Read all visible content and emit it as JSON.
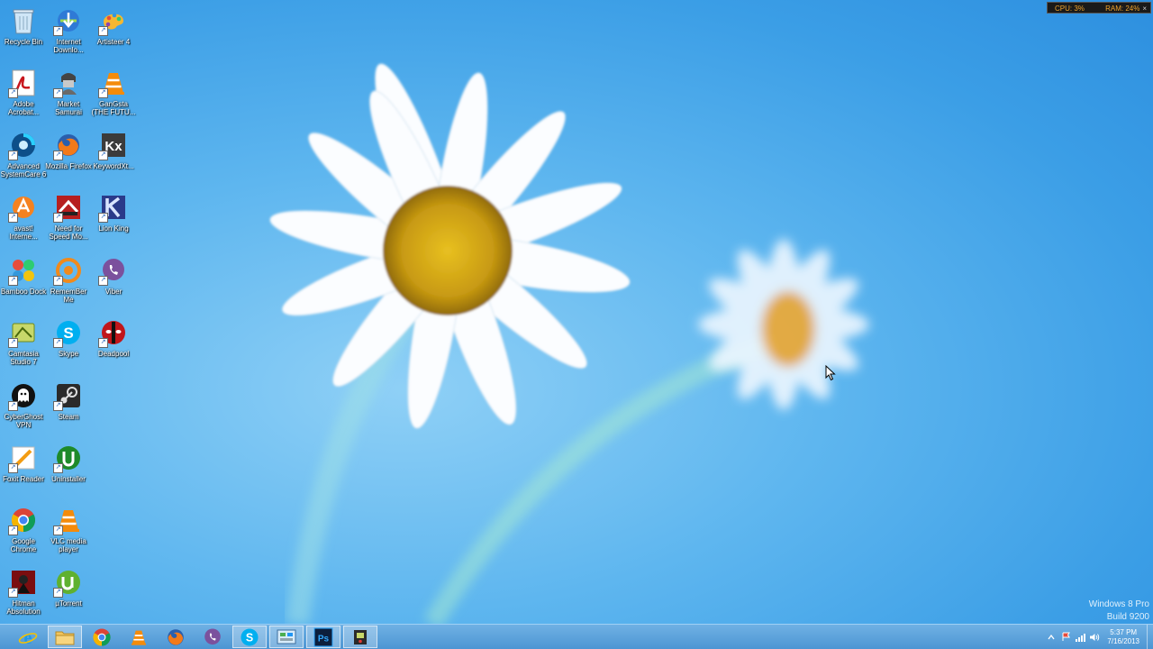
{
  "gadget": {
    "cpu": "CPU: 3%",
    "ram": "RAM: 24%",
    "close": "×"
  },
  "watermark": {
    "line1": "Windows 8 Pro",
    "line2": "Build 9200"
  },
  "desktop_icons": [
    {
      "label": "Recycle Bin"
    },
    {
      "label": "Internet Downlo..."
    },
    {
      "label": "Artisteer 4"
    },
    {
      "label": "Adobe Acrobat..."
    },
    {
      "label": "Market Samurai"
    },
    {
      "label": "GanGsta (THE FUTU..."
    },
    {
      "label": "Advanced SystemCare 6"
    },
    {
      "label": "Mozilla Firefox"
    },
    {
      "label": "KeywordXt..."
    },
    {
      "label": "avast! Interne..."
    },
    {
      "label": "Need for Speed Mo..."
    },
    {
      "label": "Lion King"
    },
    {
      "label": "Bamboo Dock"
    },
    {
      "label": "RememBer Me"
    },
    {
      "label": "Viber"
    },
    {
      "label": "Camtasia Studio 7"
    },
    {
      "label": "Skype"
    },
    {
      "label": "Deadpool"
    },
    {
      "label": "CyberGhost VPN"
    },
    {
      "label": "Steam"
    },
    {
      "label": "Foxit Reader"
    },
    {
      "label": "Uninstaller"
    },
    {
      "label": "Google Chrome"
    },
    {
      "label": "VLC media player"
    },
    {
      "label": "Hitman Absolution"
    },
    {
      "label": "µTorrent"
    }
  ],
  "taskbar": {
    "pinned": [
      "internet-explorer",
      "file-explorer",
      "google-chrome",
      "vlc-media-player",
      "mozilla-firefox",
      "viber",
      "skype",
      "control-panel",
      "photoshop",
      "camtasia-recorder"
    ],
    "ps_label": "Ps",
    "skype_label": "S"
  },
  "clock": {
    "time": "5:37 PM",
    "date": "7/16/2013"
  },
  "colors": {
    "taskbar": "#4d95d3",
    "gadget_text": "#f0a32b",
    "wallpaper": "#3b9ee6"
  }
}
